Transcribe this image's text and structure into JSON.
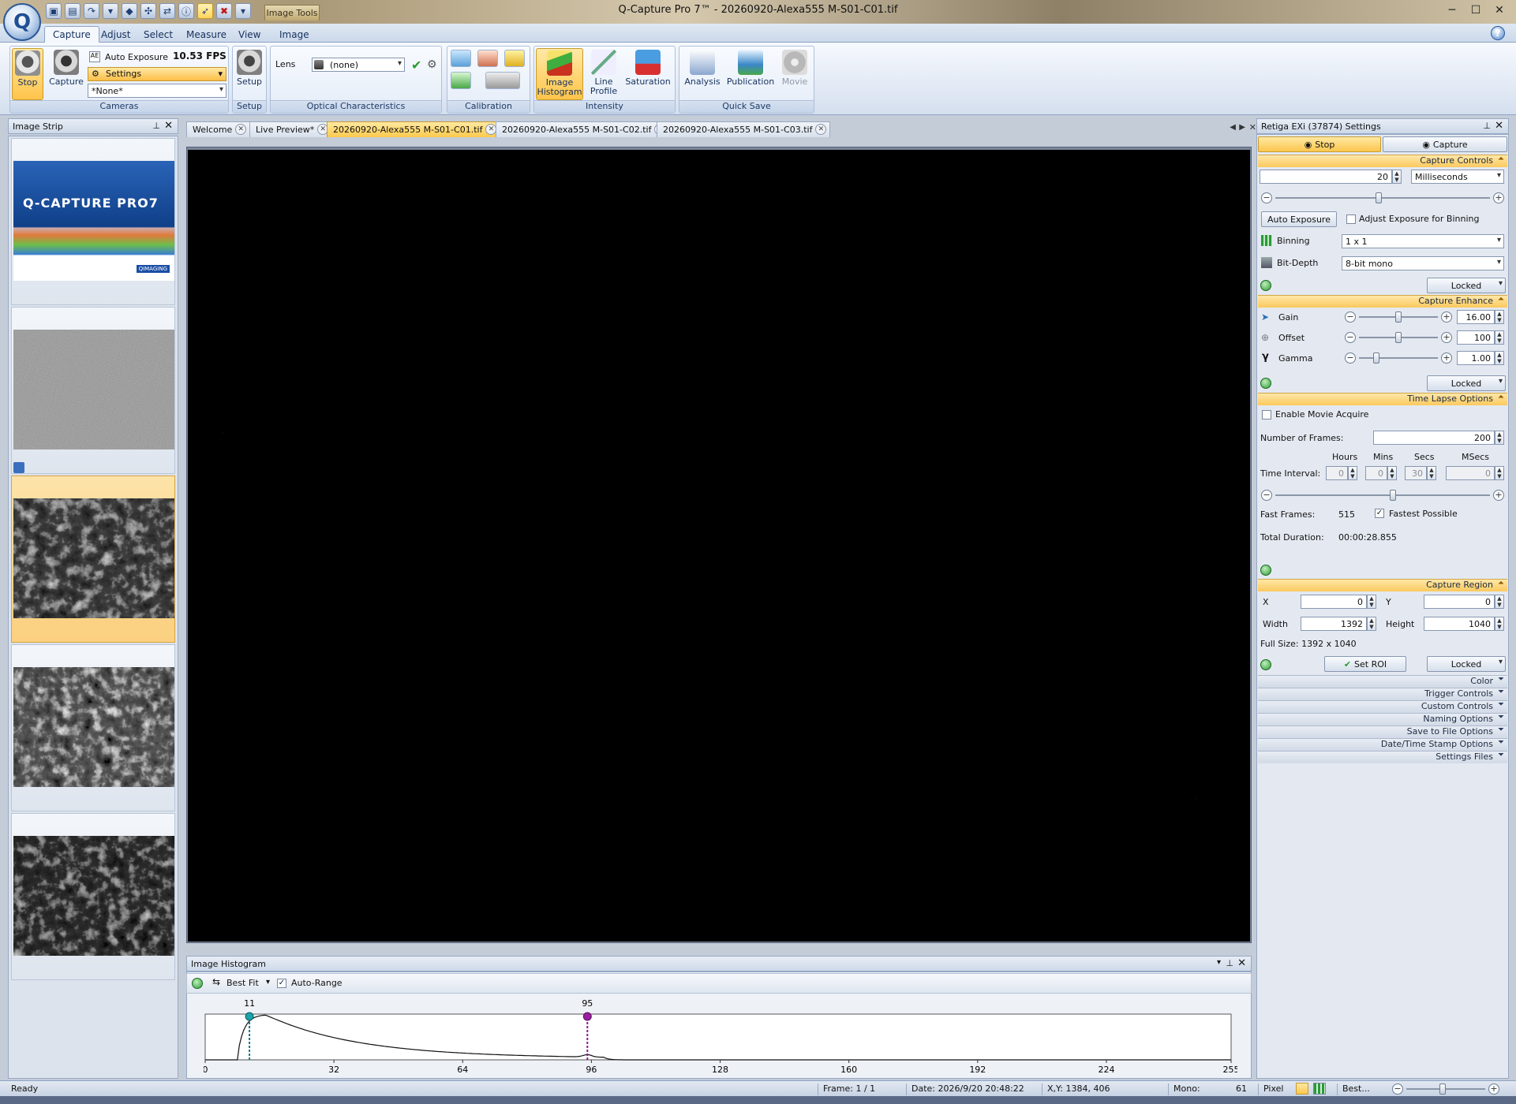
{
  "window": {
    "title": "Q-Capture Pro 7™ - 20260920-Alexa555 M-S01-C01.tif",
    "context_tab": "Image Tools"
  },
  "ribbon_tabs": [
    "Capture",
    "Adjust",
    "Select",
    "Measure",
    "View",
    "Image"
  ],
  "cameras": {
    "stop_label": "Stop",
    "capture_label": "Capture",
    "auto_exposure_label": "Auto Exposure",
    "fps": "10.53 FPS",
    "settings_label": "Settings",
    "profile_value": "*None*",
    "group_title": "Cameras"
  },
  "setup": {
    "label": "Setup",
    "group_title": "Setup"
  },
  "optical": {
    "lens_label": "Lens",
    "lens_value": "(none)",
    "group_title": "Optical Characteristics"
  },
  "calibration": {
    "group_title": "Calibration"
  },
  "intensity": {
    "histogram_label1": "Image",
    "histogram_label2": "Histogram",
    "profile_label1": "Line",
    "profile_label2": "Profile",
    "saturation_label": "Saturation",
    "group_title": "Intensity"
  },
  "quicksave": {
    "analysis_label": "Analysis",
    "publication_label": "Publication",
    "movie_label": "Movie",
    "group_title": "Quick Save"
  },
  "image_strip": {
    "title": "Image Strip",
    "splash_brand": "Q-CAPTURE PRO7",
    "splash_small": "QIMAGING"
  },
  "doc_tabs": [
    "Welcome",
    "Live Preview*",
    "20260920-Alexa555 M-S01-C01.tif",
    "20260920-Alexa555 M-S01-C02.tif",
    "20260920-Alexa555 M-S01-C03.tif"
  ],
  "histogram": {
    "title": "Image Histogram",
    "fit_label": "Best Fit",
    "auto_range_label": "Auto-Range",
    "min_marker": "11",
    "max_marker": "95",
    "ticks": [
      "0",
      "32",
      "64",
      "96",
      "128",
      "160",
      "192",
      "224",
      "255"
    ],
    "min_value": 11,
    "max_value": 95,
    "peak_value": 15
  },
  "settings": {
    "title": "Retiga EXi (37874) Settings",
    "stop_tab": "Stop",
    "capture_tab": "Capture",
    "capture_controls": {
      "title": "Capture Controls",
      "exposure_value": "20",
      "exposure_unit": "Milliseconds",
      "exposure_slider": 0.48,
      "auto_exposure_btn": "Auto Exposure",
      "adjust_binning_label": "Adjust Exposure for Binning",
      "binning_label": "Binning",
      "binning_value": "1 x 1",
      "bitdepth_label": "Bit-Depth",
      "bitdepth_value": "8-bit mono",
      "locked": "Locked"
    },
    "capture_enhance": {
      "title": "Capture Enhance",
      "gain_label": "Gain",
      "gain_value": "16.00",
      "gain_slider": 0.5,
      "offset_label": "Offset",
      "offset_value": "100",
      "offset_slider": 0.5,
      "gamma_label": "Gamma",
      "gamma_value": "1.00",
      "gamma_slider": 0.2,
      "locked": "Locked"
    },
    "time_lapse": {
      "title": "Time Lapse Options",
      "enable_label": "Enable Movie Acquire",
      "frames_label": "Number of Frames:",
      "frames_value": "200",
      "hours_label": "Hours",
      "mins_label": "Mins",
      "secs_label": "Secs",
      "msecs_label": "MSecs",
      "interval_label": "Time Interval:",
      "hours_value": "0",
      "mins_value": "0",
      "secs_value": "30",
      "msecs_value": "0",
      "interval_slider": 0.55,
      "fast_frames_label": "Fast Frames:",
      "fast_frames_value": "515",
      "fastest_label": "Fastest Possible",
      "total_label": "Total Duration:",
      "total_value": "00:00:28.855"
    },
    "capture_region": {
      "title": "Capture Region",
      "x_label": "X",
      "x_value": "0",
      "y_label": "Y",
      "y_value": "0",
      "width_label": "Width",
      "width_value": "1392",
      "height_label": "Height",
      "height_value": "1040",
      "full_size": "Full Size: 1392 x 1040",
      "set_roi": "Set ROI",
      "locked": "Locked"
    },
    "collapsed": [
      "Color",
      "Trigger Controls",
      "Custom Controls",
      "Naming Options",
      "Save to File Options",
      "Date/Time Stamp Options",
      "Settings Files"
    ]
  },
  "status": {
    "ready": "Ready",
    "frame": "Frame: 1 / 1",
    "date": "Date: 2026/9/20 20:48:22",
    "xy": "X,Y: 1384,  406",
    "mono_label": "Mono:",
    "mono_value": "61",
    "pixel": "Pixel",
    "zoom": "Best..."
  },
  "colors": {
    "accent": "#fbc95e",
    "ribbon": "#dfe8f4",
    "panel": "#e4e9f1"
  }
}
